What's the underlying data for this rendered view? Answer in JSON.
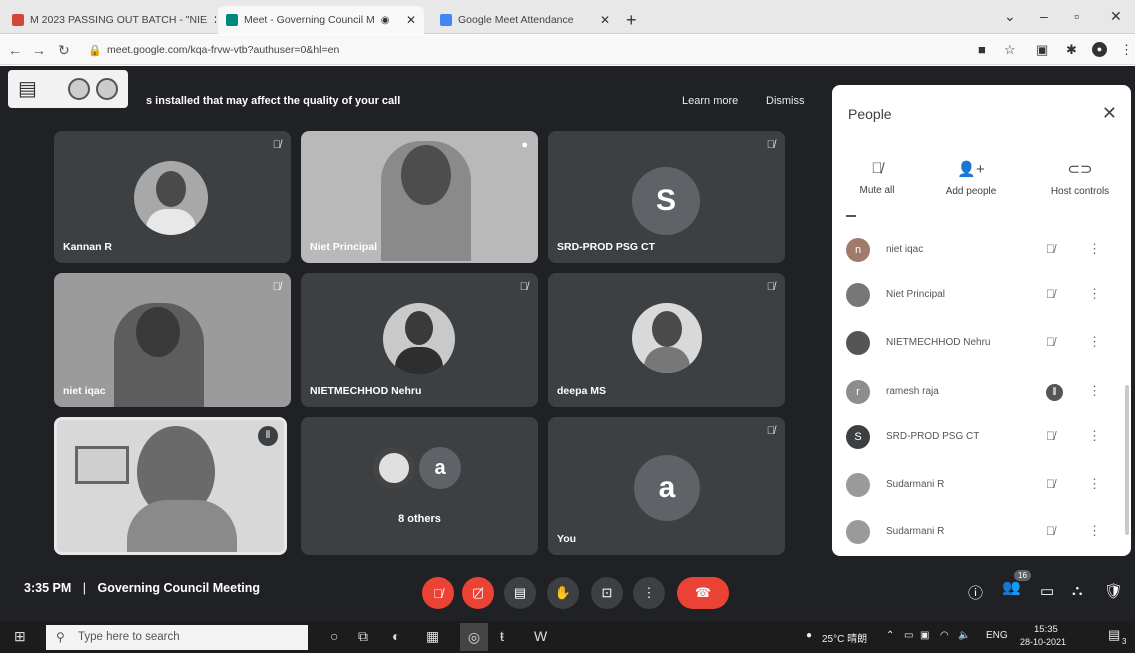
{
  "browser": {
    "tabs": [
      {
        "title": "M 2023 PASSING OUT BATCH - \"NIE",
        "favicon_color": "#d44638"
      },
      {
        "title": "Meet - Governing Council M",
        "favicon_color": "#00897b"
      },
      {
        "title": "Google Meet Attendance",
        "favicon_color": "#4285f4"
      }
    ],
    "url": "meet.google.com/kqa-frvw-vtb?authuser=0&hl=en",
    "new_tab_icon": "plus-icon"
  },
  "banner": {
    "message": "s installed that may affect the quality of your call",
    "learn_more": "Learn more",
    "dismiss": "Dismiss"
  },
  "tiles": [
    {
      "name": "Kannan R"
    },
    {
      "name": "Niet Principal"
    },
    {
      "name": "SRD-PROD PSG CT",
      "letter": "S"
    },
    {
      "name": "niet iqac"
    },
    {
      "name": "NIETMECHHOD Nehru"
    },
    {
      "name": "deepa MS"
    },
    {
      "name": ""
    },
    {
      "name": "8 others",
      "letter": "a"
    },
    {
      "name": "You",
      "letter": "a"
    }
  ],
  "people_panel": {
    "title": "People",
    "actions": [
      {
        "label": "Mute all",
        "icon": "mic-off-icon"
      },
      {
        "label": "Add people",
        "icon": "add-person-icon"
      },
      {
        "label": "Host controls",
        "icon": "toggle-icon"
      }
    ],
    "participants": [
      {
        "name": "niet iqac",
        "initial": "n"
      },
      {
        "name": "Niet Principal",
        "initial": ""
      },
      {
        "name": "NIETMECHHOD Nehru",
        "initial": ""
      },
      {
        "name": "ramesh raja",
        "initial": "r"
      },
      {
        "name": "SRD-PROD PSG CT",
        "initial": "S"
      },
      {
        "name": "Sudarmani R",
        "initial": ""
      },
      {
        "name": "Sudarmani R",
        "initial": ""
      }
    ]
  },
  "meeting": {
    "time": "3:35 PM",
    "separator": "|",
    "title": "Governing Council Meeting",
    "participant_count": "16"
  },
  "taskbar": {
    "search_placeholder": "Type here to search",
    "weather": "25°C 晴朗",
    "language": "ENG",
    "clock_time": "15:35",
    "clock_date": "28-10-2021",
    "notification_count": "3"
  }
}
